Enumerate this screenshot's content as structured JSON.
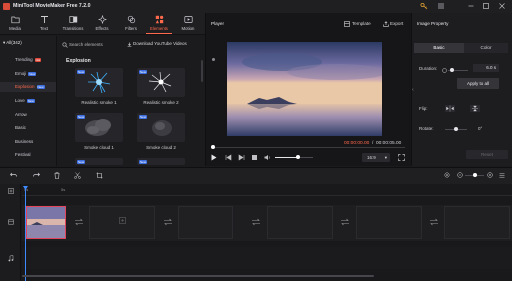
{
  "app": {
    "title": "MiniTool MovieMaker Free 7.2.0"
  },
  "toolbar": {
    "items": [
      {
        "label": "Media",
        "icon": "folder-icon"
      },
      {
        "label": "Text",
        "icon": "text-icon"
      },
      {
        "label": "Transitions",
        "icon": "transitions-icon"
      },
      {
        "label": "Effects",
        "icon": "effects-icon"
      },
      {
        "label": "Filters",
        "icon": "filters-icon"
      },
      {
        "label": "Elements",
        "icon": "elements-icon",
        "active": true
      },
      {
        "label": "Motion",
        "icon": "motion-icon"
      }
    ],
    "accent": "#ff6a4d"
  },
  "categories": {
    "header": "All(342)",
    "items": [
      {
        "label": "Trending",
        "badge": "Hot"
      },
      {
        "label": "Emoji",
        "badge": "New"
      },
      {
        "label": "Explosion",
        "badge": "New",
        "selected": true
      },
      {
        "label": "Love",
        "badge": "New"
      },
      {
        "label": "Arrow"
      },
      {
        "label": "Basic"
      },
      {
        "label": "Business"
      },
      {
        "label": "Festival"
      }
    ]
  },
  "browser": {
    "search_placeholder": "Search elements",
    "download_label": "Download YouTube Videos",
    "section_title": "Explosion",
    "new_tag": "New",
    "items": [
      {
        "label": "Realistic smoke 1"
      },
      {
        "label": "Realistic smoke 2"
      },
      {
        "label": "Smoke cloud 1"
      },
      {
        "label": "Smoke cloud 2"
      }
    ]
  },
  "player": {
    "title": "Player",
    "template_label": "Template",
    "export_label": "Export",
    "current_time": "00:00:00.00",
    "separator": "/",
    "total_time": "00:00:05.00",
    "aspect_ratio": "16:9",
    "volume_level": 0.6
  },
  "properties": {
    "title": "Image Property",
    "tab_basic": "Basic",
    "tab_color": "Color",
    "duration_label": "Duration:",
    "duration_value": "6.0 s",
    "apply_all_label": "Apply to all",
    "flip_label": "Flip:",
    "rotate_label": "Rotate:",
    "rotate_value": "0°",
    "reset_label": "Reset"
  },
  "timeline": {
    "tick_0": "0s",
    "tick_1": "5s",
    "zoom_level": 0.5
  }
}
